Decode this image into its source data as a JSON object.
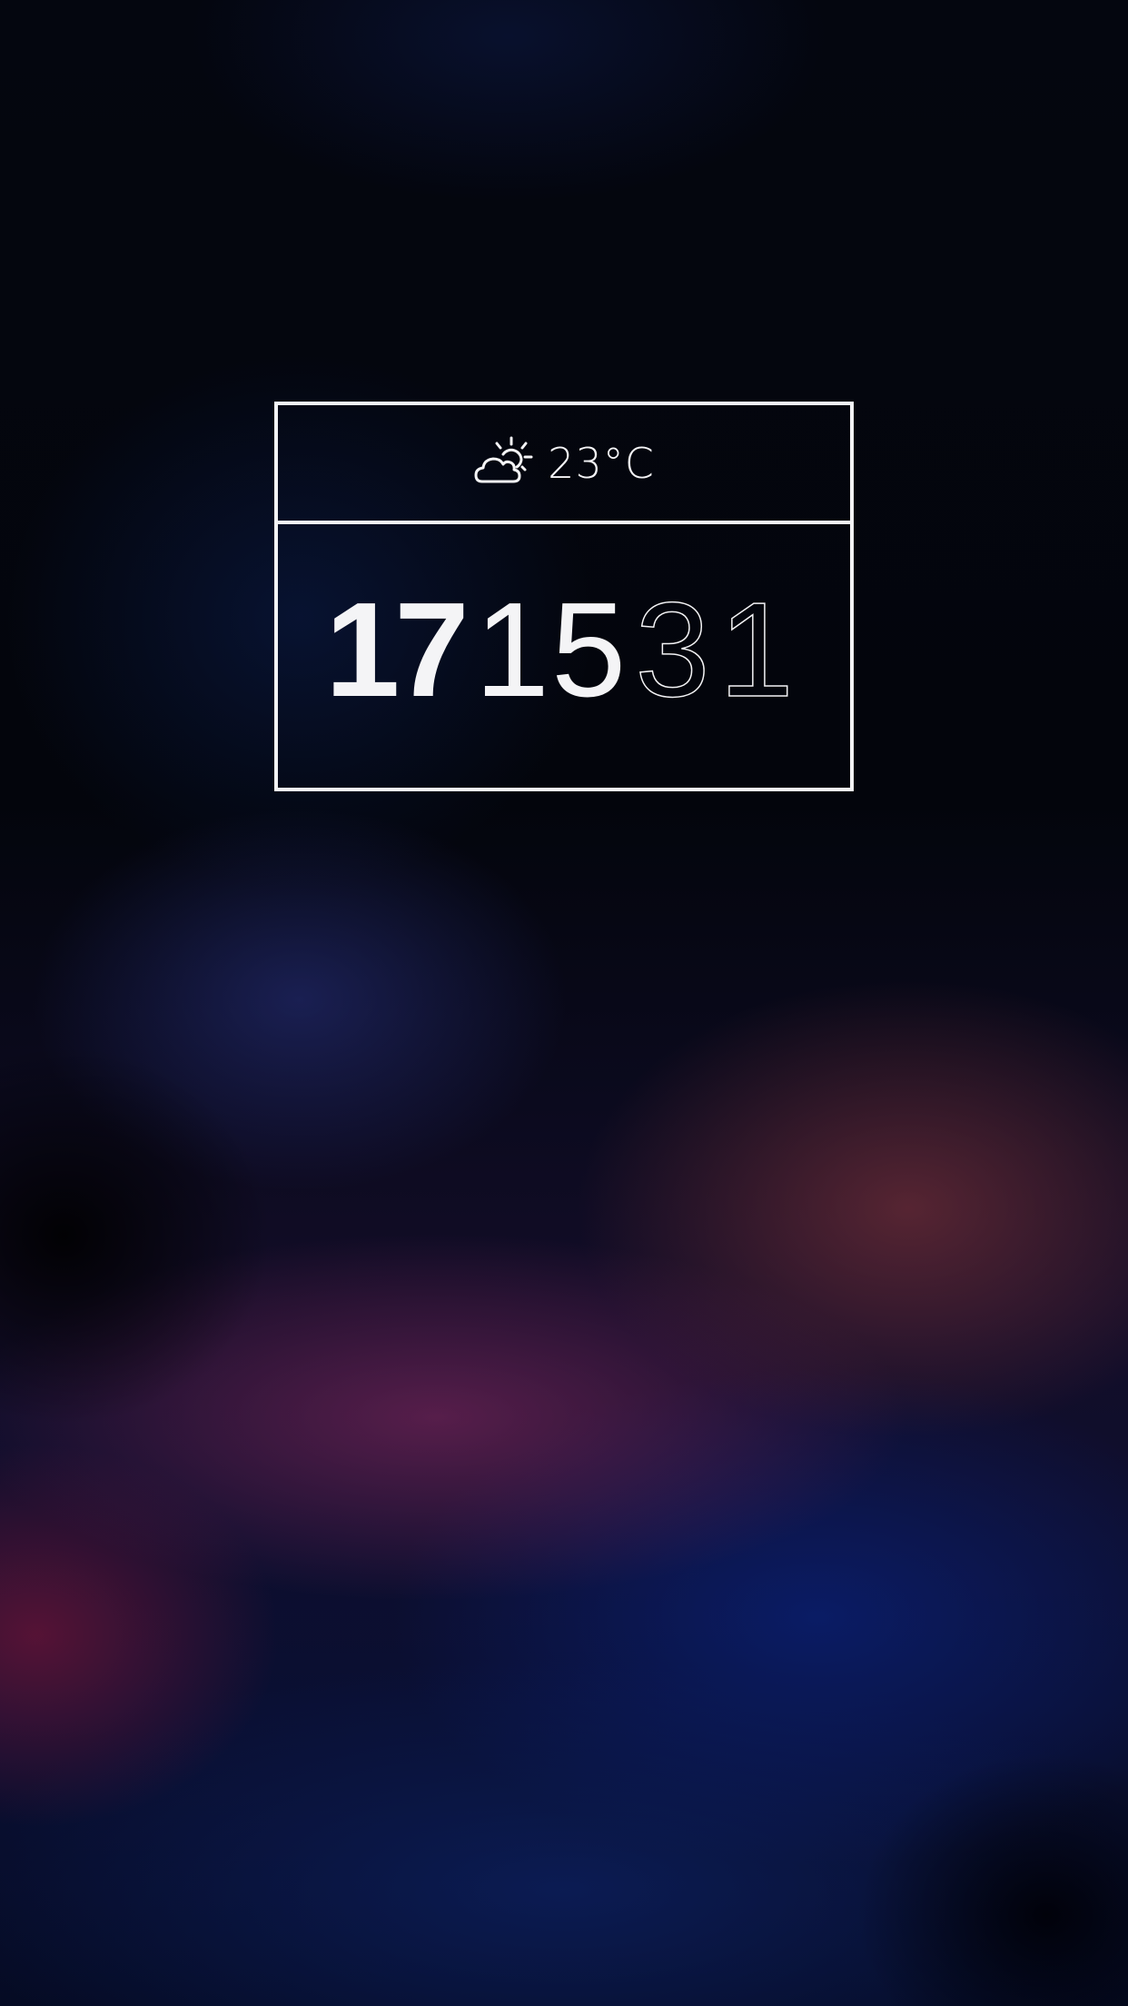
{
  "widget": {
    "weather": {
      "icon": "partly-cloudy-icon",
      "temperature": "23°C"
    },
    "time": {
      "hours": "17",
      "minutes": "15",
      "seconds": "31"
    }
  },
  "colors": {
    "foreground": "#f4f4f6",
    "background_top": "#03050c",
    "accent_red": "#6e2d55",
    "accent_blue": "#0a1e6e"
  }
}
